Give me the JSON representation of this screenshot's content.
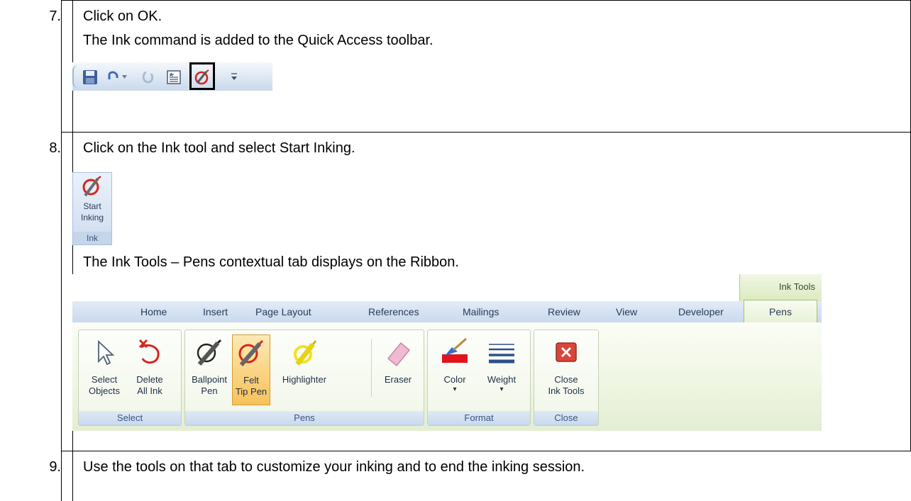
{
  "steps": [
    {
      "number": "7.",
      "lines": [
        "Click on OK.",
        "The Ink command is added to the Quick Access toolbar."
      ]
    },
    {
      "number": "8.",
      "lines": [
        "Click on the Ink tool and select Start Inking.",
        "The Ink Tools – Pens contextual tab displays on the Ribbon."
      ]
    },
    {
      "number": "9.",
      "lines": [
        "Use the tools on that tab to customize your inking and to end the inking session."
      ]
    }
  ],
  "ink_group": {
    "button_line1": "Start",
    "button_line2": "Inking",
    "group_label": "Ink"
  },
  "ribbon": {
    "contextual_header": "Ink Tools",
    "tabs": [
      "Home",
      "Insert",
      "Page Layout",
      "References",
      "Mailings",
      "Review",
      "View",
      "Developer"
    ],
    "active_tab": "Pens",
    "groups": {
      "select": {
        "label": "Select",
        "buttons": [
          [
            "Select",
            "Objects"
          ],
          [
            "Delete",
            "All Ink"
          ]
        ]
      },
      "pens": {
        "label": "Pens",
        "buttons": [
          [
            "Ballpoint",
            "Pen"
          ],
          [
            "Felt",
            "Tip Pen"
          ],
          [
            "Highlighter",
            ""
          ],
          [
            "Eraser",
            ""
          ]
        ]
      },
      "format": {
        "label": "Format",
        "buttons": [
          [
            "Color",
            "▾"
          ],
          [
            "Weight",
            "▾"
          ]
        ]
      },
      "close": {
        "label": "Close",
        "buttons": [
          [
            "Close",
            "Ink Tools"
          ]
        ]
      }
    },
    "selected_button": "Felt Tip Pen"
  },
  "colors": {
    "ribbon_blue": "#cad9ee",
    "contextual_green": "#dbeabf",
    "selected_orange": "#f8c25a"
  }
}
